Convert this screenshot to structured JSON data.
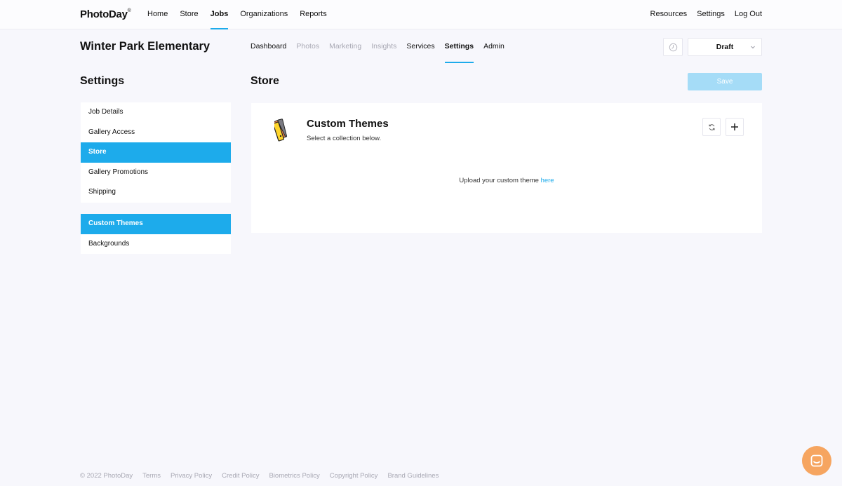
{
  "brand": {
    "name": "PhotoDay",
    "tm": "®"
  },
  "topnav": {
    "left": [
      "Home",
      "Store",
      "Jobs",
      "Organizations",
      "Reports"
    ],
    "active": "Jobs",
    "right": [
      "Resources",
      "Settings",
      "Log Out"
    ]
  },
  "job": {
    "title": "Winter Park Elementary",
    "tabs": [
      {
        "label": "Dashboard",
        "state": "normal"
      },
      {
        "label": "Photos",
        "state": "muted"
      },
      {
        "label": "Marketing",
        "state": "muted"
      },
      {
        "label": "Insights",
        "state": "muted"
      },
      {
        "label": "Services",
        "state": "normal"
      },
      {
        "label": "Settings",
        "state": "active"
      },
      {
        "label": "Admin",
        "state": "normal"
      }
    ],
    "status": "Draft"
  },
  "settings": {
    "heading": "Settings",
    "group1": [
      "Job Details",
      "Gallery Access",
      "Store",
      "Gallery Promotions",
      "Shipping"
    ],
    "group1_active": "Store",
    "group2": [
      "Custom Themes",
      "Backgrounds"
    ],
    "group2_active": "Custom Themes"
  },
  "store": {
    "heading": "Store",
    "save_label": "Save",
    "card": {
      "title": "Custom Themes",
      "subtitle": "Select a collection below.",
      "upload_text": "Upload your custom theme ",
      "upload_link": "here"
    }
  },
  "footer": {
    "copyright": "© 2022 PhotoDay",
    "links": [
      "Terms",
      "Privacy Policy",
      "Credit Policy",
      "Biometrics Policy",
      "Copyright Policy",
      "Brand Guidelines"
    ]
  },
  "colors": {
    "accent": "#1dabeb",
    "save_disabled": "#a5dcf7",
    "chat": "#f6a560",
    "background": "#f7f7fc"
  },
  "icons": [
    "swatch-icon",
    "refresh-icon",
    "plus-icon",
    "clock-icon",
    "chevron-down-icon",
    "chat-icon"
  ]
}
